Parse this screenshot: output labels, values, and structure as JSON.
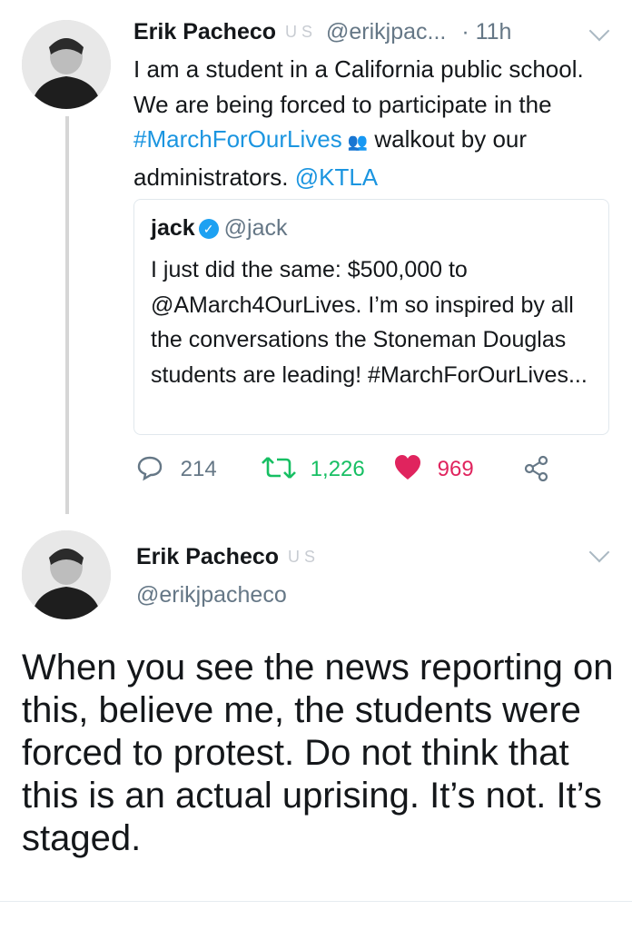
{
  "tweet1": {
    "author_name": "Erik Pacheco",
    "badges": "U S",
    "handle": "@erikjpac...",
    "time": "· 11h",
    "text_parts": {
      "p1": "I am a student in a California public school. We are being forced to participate in the ",
      "hashtag": "#MarchForOurLives",
      "emoji": "👥",
      "p2": " walkout by our administrators. ",
      "mention": "@KTLA"
    },
    "quote": {
      "name": "jack",
      "handle": "@jack",
      "text": "I just did the same: $500,000 to @AMarch4OurLives. I’m so inspired by all the conversations the Stoneman Douglas students are leading! #MarchForOurLives..."
    },
    "actions": {
      "replies": "214",
      "retweets": "1,226",
      "likes": "969"
    }
  },
  "tweet2": {
    "author_name": "Erik Pacheco",
    "badges": "U S",
    "handle": "@erikjpacheco",
    "text": "When you see the news reporting on this, believe me, the students were forced to protest. Do not think that this is an actual uprising. It’s not. It’s staged."
  },
  "colors": {
    "link": "#1b95e0",
    "retweet": "#17bf63",
    "like": "#e0245e",
    "muted": "#657786"
  },
  "icons": {
    "reply": "reply-icon",
    "retweet": "retweet-icon",
    "like": "heart-icon",
    "share": "share-icon",
    "menu": "chevron-down-icon",
    "verified": "verified-badge-icon"
  }
}
